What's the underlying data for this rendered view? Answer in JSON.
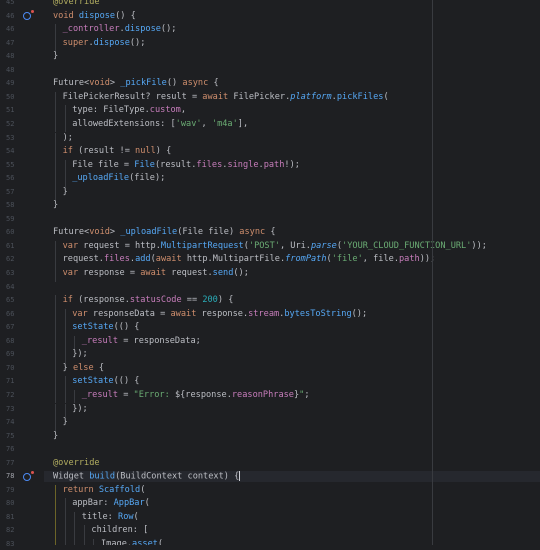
{
  "editor": {
    "active_line": "78",
    "lines": [
      {
        "n": "45",
        "indent": 0,
        "tokens": [
          [
            "a",
            "@override"
          ]
        ]
      },
      {
        "n": "46",
        "indent": 0,
        "tokens": [
          [
            "k",
            "void "
          ],
          [
            "f",
            "dispose"
          ],
          [
            "t",
            "() {"
          ]
        ],
        "marker": true
      },
      {
        "n": "46",
        "indent": 1,
        "tokens": [
          [
            "p",
            "_controller"
          ],
          [
            "t",
            "."
          ],
          [
            "f",
            "dispose"
          ],
          [
            "t",
            "();"
          ]
        ]
      },
      {
        "n": "47",
        "indent": 1,
        "tokens": [
          [
            "k",
            "super"
          ],
          [
            "t",
            "."
          ],
          [
            "f",
            "dispose"
          ],
          [
            "t",
            "();"
          ]
        ]
      },
      {
        "n": "48",
        "indent": 0,
        "tokens": [
          [
            "t",
            "}"
          ]
        ]
      },
      {
        "n": "48",
        "indent": 0,
        "tokens": []
      },
      {
        "n": "49",
        "indent": 0,
        "tokens": [
          [
            "t",
            "Future<"
          ],
          [
            "k",
            "void"
          ],
          [
            "t",
            "> "
          ],
          [
            "f",
            "_pickFile"
          ],
          [
            "t",
            "() "
          ],
          [
            "k",
            "async"
          ],
          [
            "t",
            " {"
          ]
        ]
      },
      {
        "n": "50",
        "indent": 1,
        "tokens": [
          [
            "t",
            "FilePickerResult? result = "
          ],
          [
            "k",
            "await "
          ],
          [
            "t",
            "FilePicker."
          ],
          [
            "sf",
            "platform"
          ],
          [
            "t",
            "."
          ],
          [
            "f",
            "pickFiles"
          ],
          [
            "t",
            "("
          ]
        ]
      },
      {
        "n": "51",
        "indent": 2,
        "tokens": [
          [
            "t",
            "type: FileType."
          ],
          [
            "p",
            "custom"
          ],
          [
            "t",
            ","
          ]
        ]
      },
      {
        "n": "52",
        "indent": 2,
        "tokens": [
          [
            "t",
            "allowedExtensions: ["
          ],
          [
            "s",
            "'wav'"
          ],
          [
            "t",
            ", "
          ],
          [
            "s",
            "'m4a'"
          ],
          [
            "t",
            "],"
          ]
        ]
      },
      {
        "n": "53",
        "indent": 1,
        "tokens": [
          [
            "t",
            ");"
          ]
        ]
      },
      {
        "n": "54",
        "indent": 1,
        "tokens": [
          [
            "k",
            "if "
          ],
          [
            "t",
            "(result != "
          ],
          [
            "k",
            "null"
          ],
          [
            "t",
            ") {"
          ]
        ]
      },
      {
        "n": "55",
        "indent": 2,
        "tokens": [
          [
            "t",
            "File file = "
          ],
          [
            "f",
            "File"
          ],
          [
            "t",
            "(result."
          ],
          [
            "p",
            "files"
          ],
          [
            "t",
            "."
          ],
          [
            "p",
            "single"
          ],
          [
            "t",
            "."
          ],
          [
            "p",
            "path"
          ],
          [
            "t",
            "!);"
          ]
        ]
      },
      {
        "n": "56",
        "indent": 2,
        "tokens": [
          [
            "f",
            "_uploadFile"
          ],
          [
            "t",
            "(file);"
          ]
        ]
      },
      {
        "n": "57",
        "indent": 1,
        "tokens": [
          [
            "t",
            "}"
          ]
        ]
      },
      {
        "n": "58",
        "indent": 0,
        "tokens": [
          [
            "t",
            "}"
          ]
        ]
      },
      {
        "n": "59",
        "indent": 0,
        "tokens": []
      },
      {
        "n": "60",
        "indent": 0,
        "tokens": [
          [
            "t",
            "Future<"
          ],
          [
            "k",
            "void"
          ],
          [
            "t",
            "> "
          ],
          [
            "f",
            "_uploadFile"
          ],
          [
            "t",
            "(File file) "
          ],
          [
            "k",
            "async"
          ],
          [
            "t",
            " {"
          ]
        ]
      },
      {
        "n": "61",
        "indent": 1,
        "tokens": [
          [
            "k",
            "var "
          ],
          [
            "t",
            "request = http."
          ],
          [
            "f",
            "MultipartRequest"
          ],
          [
            "t",
            "("
          ],
          [
            "s",
            "'POST'"
          ],
          [
            "t",
            ", Uri."
          ],
          [
            "sf",
            "parse"
          ],
          [
            "t",
            "("
          ],
          [
            "s",
            "'YOUR_CLOUD_FUNCTION_URL'"
          ],
          [
            "t",
            "));"
          ]
        ]
      },
      {
        "n": "62",
        "indent": 1,
        "tokens": [
          [
            "t",
            "request."
          ],
          [
            "p",
            "files"
          ],
          [
            "t",
            "."
          ],
          [
            "f",
            "add"
          ],
          [
            "t",
            "("
          ],
          [
            "k",
            "await "
          ],
          [
            "t",
            "http.MultipartFile."
          ],
          [
            "sf",
            "fromPath"
          ],
          [
            "t",
            "("
          ],
          [
            "s",
            "'file'"
          ],
          [
            "t",
            ", file."
          ],
          [
            "p",
            "path"
          ],
          [
            "t",
            "));"
          ]
        ]
      },
      {
        "n": "63",
        "indent": 1,
        "tokens": [
          [
            "k",
            "var "
          ],
          [
            "t",
            "response = "
          ],
          [
            "k",
            "await "
          ],
          [
            "t",
            "request."
          ],
          [
            "f",
            "send"
          ],
          [
            "t",
            "();"
          ]
        ]
      },
      {
        "n": "64",
        "indent": 0,
        "tokens": []
      },
      {
        "n": "65",
        "indent": 1,
        "tokens": [
          [
            "k",
            "if "
          ],
          [
            "t",
            "(response."
          ],
          [
            "p",
            "statusCode"
          ],
          [
            "t",
            " == "
          ],
          [
            "n",
            "200"
          ],
          [
            "t",
            ") {"
          ]
        ]
      },
      {
        "n": "66",
        "indent": 2,
        "tokens": [
          [
            "k",
            "var "
          ],
          [
            "t",
            "responseData = "
          ],
          [
            "k",
            "await "
          ],
          [
            "t",
            "response."
          ],
          [
            "p",
            "stream"
          ],
          [
            "t",
            "."
          ],
          [
            "f",
            "bytesToString"
          ],
          [
            "t",
            "();"
          ]
        ]
      },
      {
        "n": "67",
        "indent": 2,
        "tokens": [
          [
            "f",
            "setState"
          ],
          [
            "t",
            "(() {"
          ]
        ]
      },
      {
        "n": "68",
        "indent": 3,
        "tokens": [
          [
            "p",
            "_result"
          ],
          [
            "t",
            " = responseData;"
          ]
        ]
      },
      {
        "n": "69",
        "indent": 2,
        "tokens": [
          [
            "t",
            "});"
          ]
        ]
      },
      {
        "n": "70",
        "indent": 1,
        "tokens": [
          [
            "t",
            "} "
          ],
          [
            "k",
            "else"
          ],
          [
            "t",
            " {"
          ]
        ]
      },
      {
        "n": "71",
        "indent": 2,
        "tokens": [
          [
            "f",
            "setState"
          ],
          [
            "t",
            "(() {"
          ]
        ]
      },
      {
        "n": "72",
        "indent": 3,
        "tokens": [
          [
            "p",
            "_result"
          ],
          [
            "t",
            " = "
          ],
          [
            "s",
            "\"Error: "
          ],
          [
            "t",
            "${response."
          ],
          [
            "p",
            "reasonPhrase"
          ],
          [
            "t",
            "}"
          ],
          [
            "s",
            "\""
          ],
          [
            "t",
            ";"
          ]
        ]
      },
      {
        "n": "73",
        "indent": 2,
        "tokens": [
          [
            "t",
            "});"
          ]
        ]
      },
      {
        "n": "74",
        "indent": 1,
        "tokens": [
          [
            "t",
            "}"
          ]
        ]
      },
      {
        "n": "75",
        "indent": 0,
        "tokens": [
          [
            "t",
            "}"
          ]
        ]
      },
      {
        "n": "76",
        "indent": 0,
        "tokens": []
      },
      {
        "n": "77",
        "indent": 0,
        "tokens": [
          [
            "a",
            "@override"
          ]
        ]
      },
      {
        "n": "78",
        "indent": 0,
        "tokens": [
          [
            "t",
            "Widget "
          ],
          [
            "f",
            "build"
          ],
          [
            "t",
            "(BuildContext context) "
          ],
          [
            "t",
            "{"
          ]
        ],
        "marker": true,
        "active": true,
        "caret": true
      },
      {
        "n": "79",
        "indent": 1,
        "tokens": [
          [
            "k",
            "return "
          ],
          [
            "f",
            "Scaffold"
          ],
          [
            "t",
            "("
          ]
        ]
      },
      {
        "n": "80",
        "indent": 2,
        "tokens": [
          [
            "t",
            "appBar: "
          ],
          [
            "f",
            "AppBar"
          ],
          [
            "t",
            "("
          ]
        ]
      },
      {
        "n": "81",
        "indent": 3,
        "tokens": [
          [
            "t",
            "title: "
          ],
          [
            "f",
            "Row"
          ],
          [
            "t",
            "("
          ]
        ]
      },
      {
        "n": "82",
        "indent": 4,
        "tokens": [
          [
            "t",
            "children: ["
          ]
        ]
      },
      {
        "n": "83",
        "indent": 5,
        "tokens": [
          [
            "t",
            "Image."
          ],
          [
            "f",
            "asset"
          ],
          [
            "t",
            "("
          ]
        ]
      }
    ]
  }
}
